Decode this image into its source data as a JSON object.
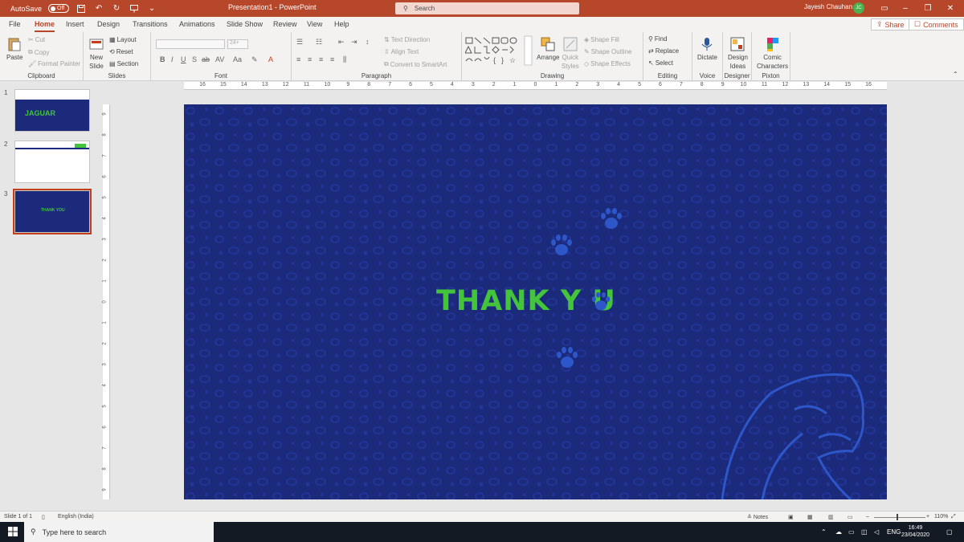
{
  "titlebar": {
    "autosave_label": "AutoSave",
    "autosave_state": "Off",
    "doc_title": "Presentation1  -  PowerPoint",
    "search_placeholder": "Search",
    "user_name": "Jayesh Chauhan",
    "user_initials": "JC"
  },
  "tabs": [
    "File",
    "Home",
    "Insert",
    "Design",
    "Transitions",
    "Animations",
    "Slide Show",
    "Review",
    "View",
    "Help"
  ],
  "active_tab": "Home",
  "share_label": "Share",
  "comments_label": "Comments",
  "ribbon": {
    "clipboard": {
      "label": "Clipboard",
      "paste": "Paste",
      "cut": "Cut",
      "copy": "Copy",
      "format_painter": "Format Painter"
    },
    "slides": {
      "label": "Slides",
      "new_slide": "New",
      "new_slide2": "Slide",
      "layout": "Layout",
      "reset": "Reset",
      "section": "Section"
    },
    "font": {
      "label": "Font",
      "size_placeholder": "24+"
    },
    "paragraph": {
      "label": "Paragraph",
      "text_direction": "Text Direction",
      "align_text": "Align Text",
      "convert_smartart": "Convert to SmartArt"
    },
    "drawing": {
      "label": "Drawing",
      "arrange": "Arrange",
      "quick_styles": "Quick",
      "quick_styles2": "Styles",
      "shape_fill": "Shape Fill",
      "shape_outline": "Shape Outline",
      "shape_effects": "Shape Effects"
    },
    "editing": {
      "label": "Editing",
      "find": "Find",
      "replace": "Replace",
      "select": "Select"
    },
    "voice": {
      "label": "Voice",
      "dictate": "Dictate"
    },
    "designer": {
      "label": "Designer",
      "design_ideas": "Design",
      "design_ideas2": "Ideas"
    },
    "pixton": {
      "label": "Pixton",
      "comic": "Comic",
      "comic2": "Characters"
    }
  },
  "hruler_ticks": [
    "16",
    "15",
    "14",
    "13",
    "12",
    "11",
    "10",
    "9",
    "8",
    "7",
    "6",
    "5",
    "4",
    "3",
    "2",
    "1",
    "0",
    "1",
    "2",
    "3",
    "4",
    "5",
    "6",
    "7",
    "8",
    "9",
    "10",
    "11",
    "12",
    "13",
    "14",
    "15",
    "16"
  ],
  "vruler_ticks": [
    "9",
    "8",
    "7",
    "6",
    "5",
    "4",
    "3",
    "2",
    "1",
    "0",
    "1",
    "2",
    "3",
    "4",
    "5",
    "6",
    "7",
    "8",
    "9"
  ],
  "thumbnails": [
    {
      "number": "1",
      "title": "JAGUAR"
    },
    {
      "number": "2",
      "title": ""
    },
    {
      "number": "3",
      "title": "THANK YOU"
    }
  ],
  "slide": {
    "text": "THANK Y  U",
    "accent_color": "#43c43a",
    "background_color": "#1b2a7a"
  },
  "statusbar": {
    "slide_info": "Slide 1 of 1",
    "language": "English (India)",
    "notes": "Notes",
    "zoom": "110%"
  },
  "taskbar": {
    "search_placeholder": "Type here to search",
    "lang": "ENG",
    "time": "16:49",
    "date": "23/04/2020"
  }
}
